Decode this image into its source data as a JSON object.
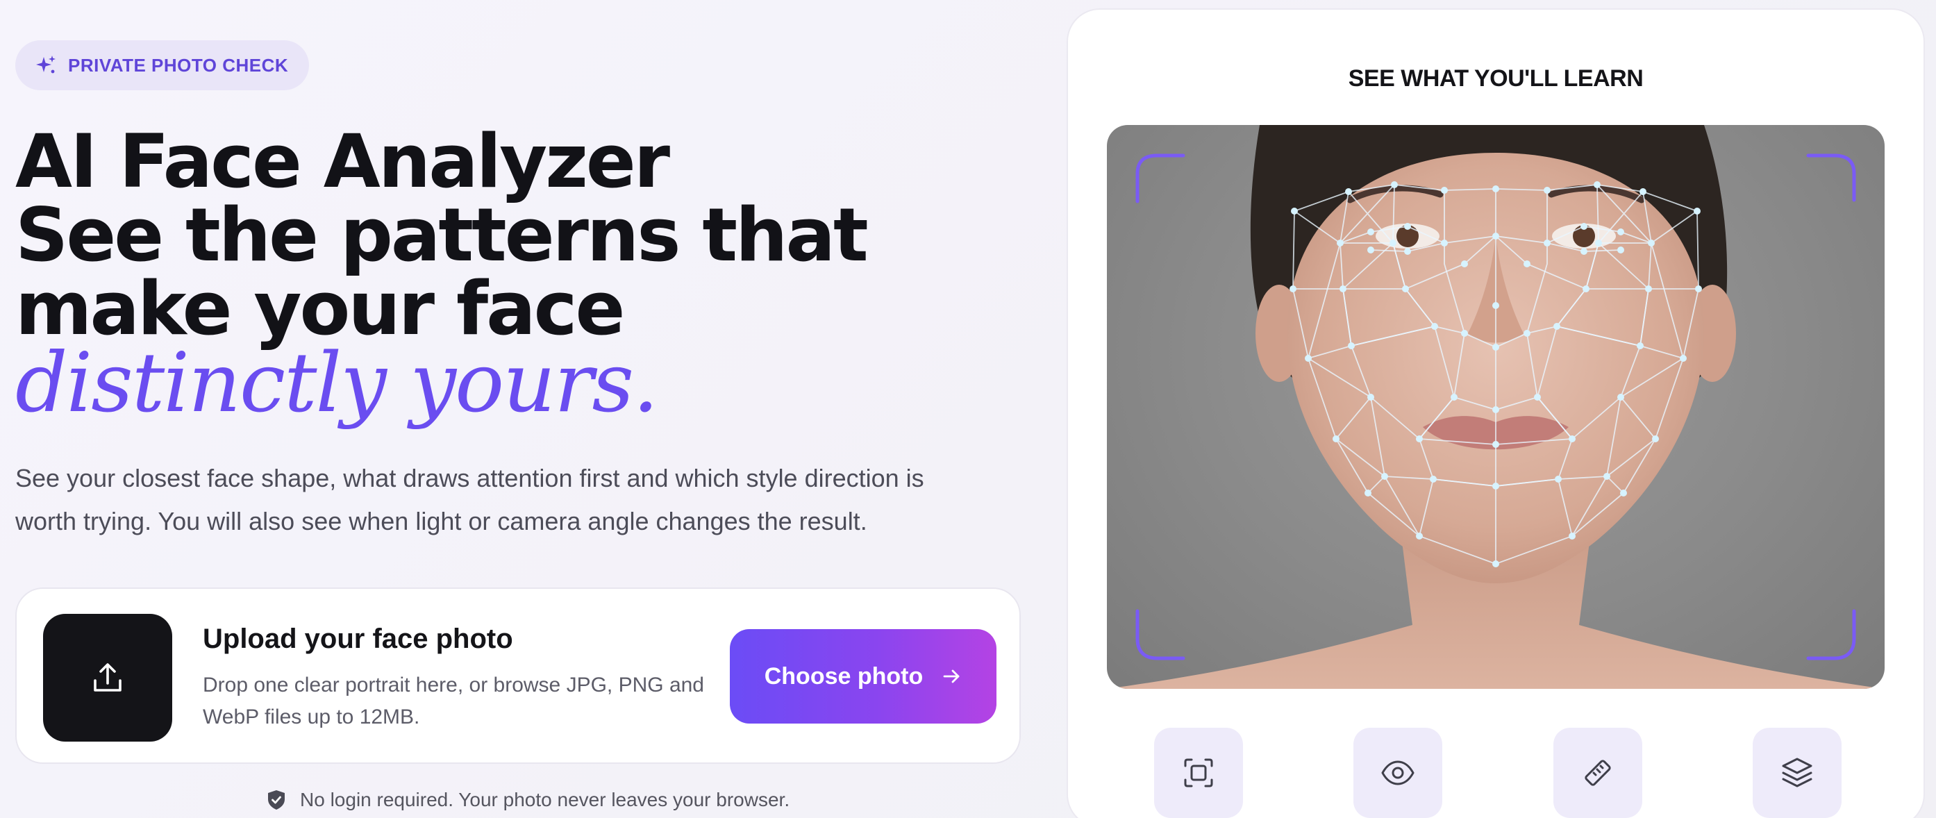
{
  "hero": {
    "badge_label": "PRIVATE PHOTO CHECK",
    "headline_line1": "AI Face Analyzer",
    "headline_line2": "See the patterns that",
    "headline_line3": "make your face",
    "headline_accent": "distinctly yours.",
    "subcopy": "See your closest face shape, what draws attention first and which style direction is worth trying. You will also see when light or camera angle changes the result."
  },
  "upload": {
    "title": "Upload your face photo",
    "description": "Drop one clear portrait here, or browse JPG, PNG and WebP files up to 12MB.",
    "button_label": "Choose photo",
    "icon": "upload-icon"
  },
  "privacy_note": "No login required. Your photo never leaves your browser.",
  "preview_panel": {
    "title": "SEE WHAT YOU'LL LEARN",
    "features": [
      {
        "icon": "face-frame-icon"
      },
      {
        "icon": "eye-icon"
      },
      {
        "icon": "ruler-icon"
      },
      {
        "icon": "layers-icon"
      }
    ]
  },
  "colors": {
    "accent": "#6a4df0",
    "button_gradient_start": "#6b4cf6",
    "button_gradient_end": "#b443e4",
    "badge_bg": "#e9e5f8",
    "dark_tile": "#141418"
  }
}
